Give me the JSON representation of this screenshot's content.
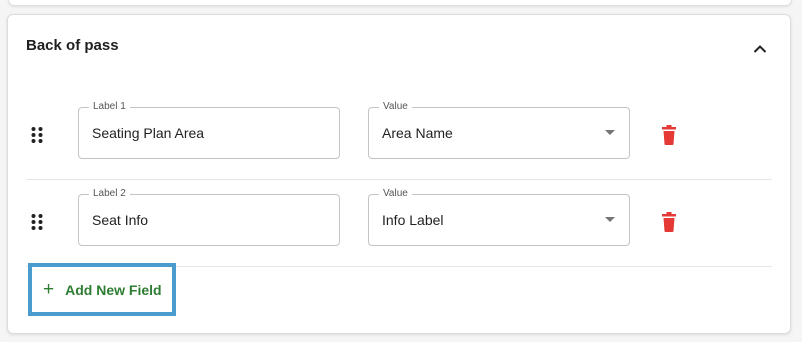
{
  "section": {
    "title": "Back of pass"
  },
  "fields": [
    {
      "label_legend": "Label 1",
      "label_value": "Seating Plan Area",
      "value_legend": "Value",
      "value_selected": "Area Name"
    },
    {
      "label_legend": "Label 2",
      "label_value": "Seat Info",
      "value_legend": "Value",
      "value_selected": "Info Label"
    }
  ],
  "add_button": {
    "label": "Add New Field",
    "icon": "plus-icon"
  },
  "icons": {
    "collapse": "chevron-up-icon",
    "drag": "drag-handle-icon",
    "delete": "trash-icon",
    "dropdown": "caret-down-icon"
  },
  "colors": {
    "accent_green": "#2e7d32",
    "delete_red": "#e53935",
    "highlight_blue": "#4a9ccf"
  }
}
